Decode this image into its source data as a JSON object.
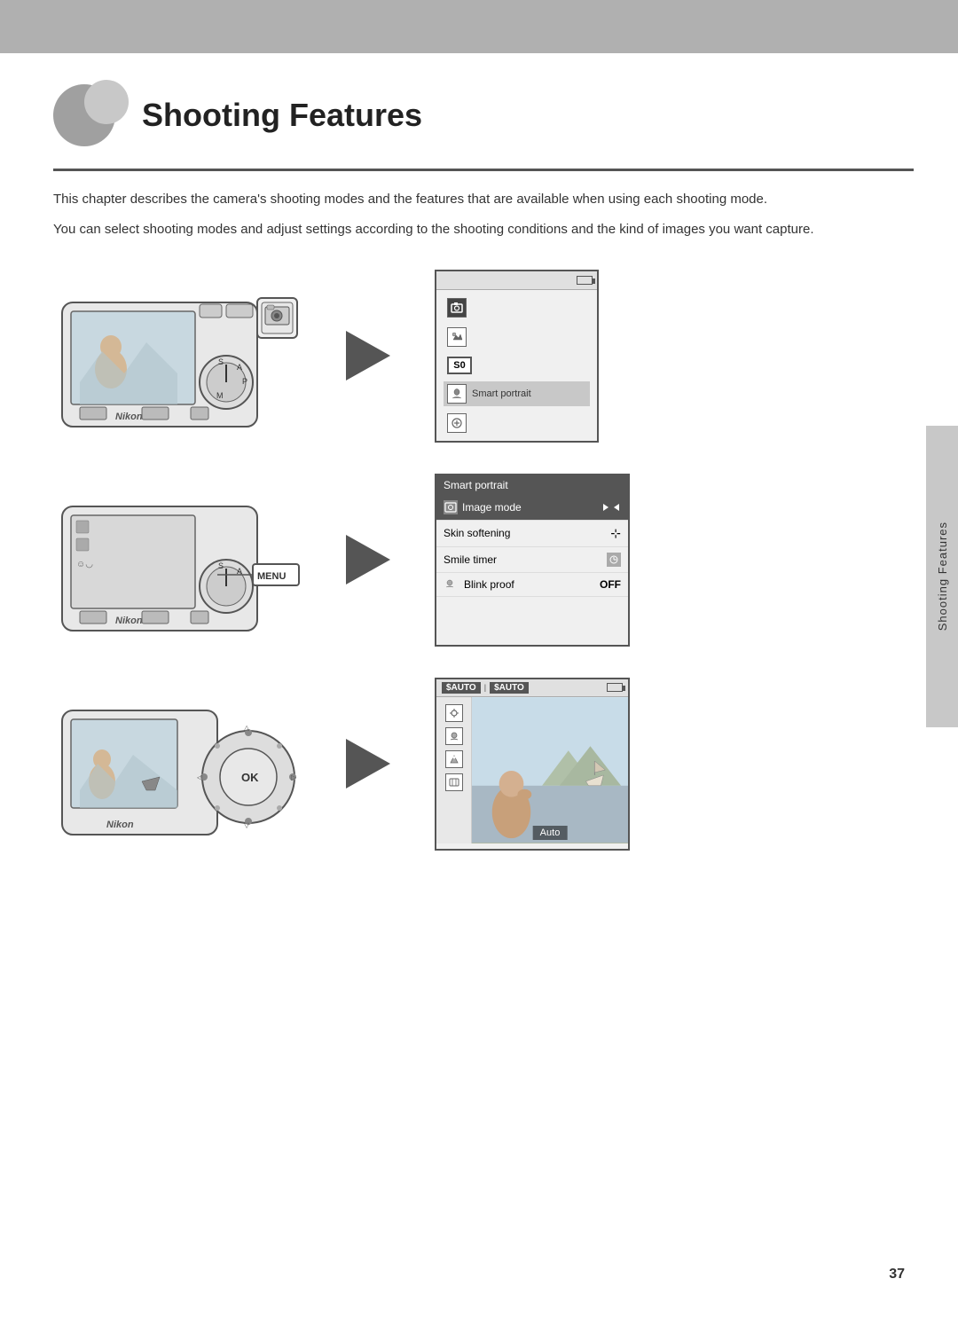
{
  "top_bar": {},
  "side_tab": {
    "label": "Shooting Features"
  },
  "title": "Shooting Features",
  "description1": "This chapter describes the camera's shooting modes and the features that are available when using each shooting mode.",
  "description2": "You can select shooting modes and adjust settings according to the shooting conditions and the kind of images you want capture.",
  "section1": {
    "arrow_label": "arrow",
    "screen_title": "Smart portrait",
    "mode_items": [
      {
        "icon": "cam",
        "label": ""
      },
      {
        "icon": "grid",
        "label": ""
      },
      {
        "icon": "S0",
        "label": ""
      },
      {
        "icon": "port",
        "label": "Smart portrait"
      },
      {
        "icon": "plus",
        "label": ""
      }
    ]
  },
  "section2": {
    "menu_label": "MENU",
    "screen_title": "Smart portrait",
    "menu_items": [
      {
        "label": "Image mode",
        "value": ""
      },
      {
        "label": "Skin softening",
        "value": ""
      },
      {
        "label": "Smile timer",
        "value": ""
      },
      {
        "label": "Blink proof",
        "value": "OFF"
      }
    ]
  },
  "section3": {
    "tags": [
      "$AUTO",
      "$AUTO"
    ],
    "bottom_label": "Auto"
  },
  "page_number": "37"
}
